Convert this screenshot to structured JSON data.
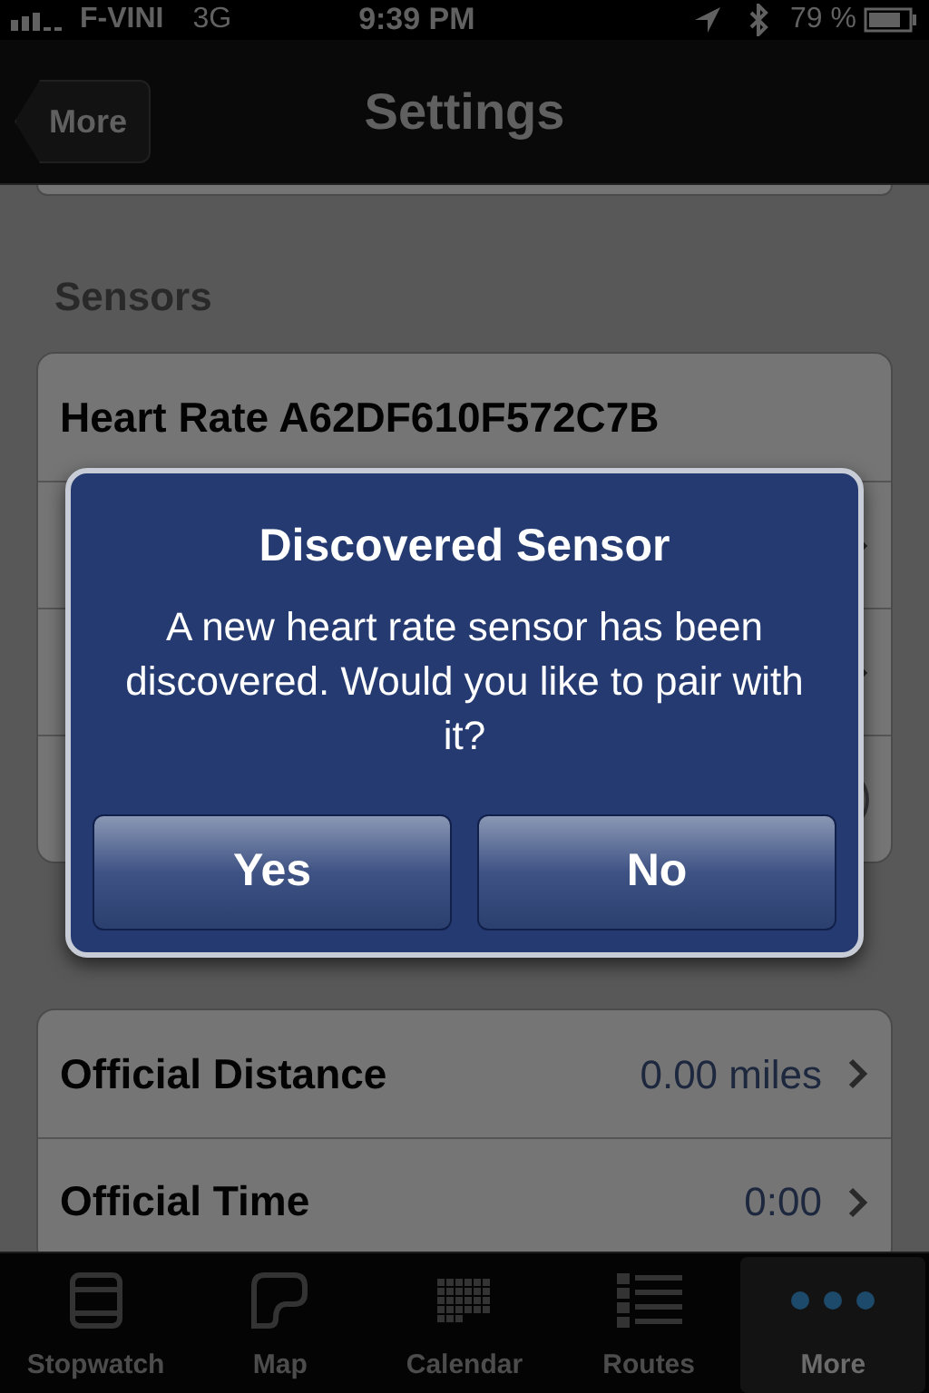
{
  "status_bar": {
    "carrier": "F-VINI",
    "network": "3G",
    "time": "9:39 PM",
    "battery": "79 %"
  },
  "nav_bar": {
    "back": "More",
    "title": "Settings"
  },
  "sections": [
    {
      "header": "Sensors",
      "rows": [
        {
          "kind": "text",
          "label": "Heart Rate A62DF610F572C7B"
        },
        {
          "kind": "link"
        },
        {
          "kind": "link"
        },
        {
          "kind": "switch",
          "on": true
        }
      ]
    },
    {
      "rows": [
        {
          "kind": "link",
          "label": "Official Distance",
          "value": "0.00 miles"
        },
        {
          "kind": "link",
          "label": "Official Time",
          "value": "0:00"
        }
      ]
    }
  ],
  "alert": {
    "title": "Discovered Sensor",
    "message": "A new heart rate sensor has been discovered.  Would you like to pair with it?",
    "buttons": [
      "Yes",
      "No"
    ]
  },
  "tab_bar": [
    {
      "label": "Stopwatch",
      "selected": false
    },
    {
      "label": "Map",
      "selected": false
    },
    {
      "label": "Calendar",
      "selected": false
    },
    {
      "label": "Routes",
      "selected": false
    },
    {
      "label": "More",
      "selected": true
    }
  ]
}
